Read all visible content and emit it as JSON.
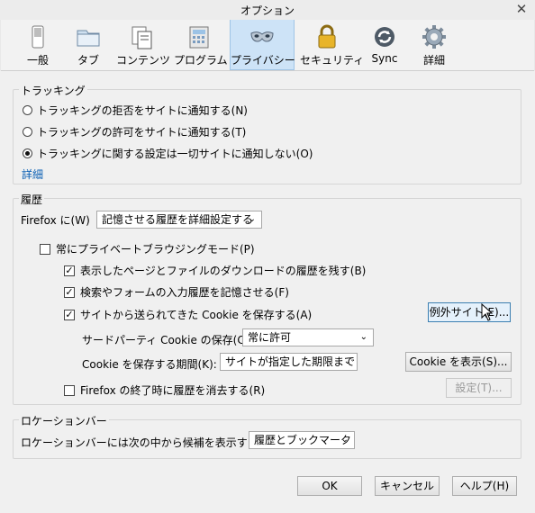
{
  "window": {
    "title": "オプション",
    "close_glyph": "✕"
  },
  "tabs": [
    {
      "label": "一般",
      "icon": "switch-icon"
    },
    {
      "label": "タブ",
      "icon": "folder-tab-icon"
    },
    {
      "label": "コンテンツ",
      "icon": "page-content-icon"
    },
    {
      "label": "プログラム",
      "icon": "calculator-icon"
    },
    {
      "label": "プライバシー",
      "icon": "mask-icon",
      "active": true
    },
    {
      "label": "セキュリティ",
      "icon": "padlock-icon"
    },
    {
      "label": "Sync",
      "icon": "sync-icon"
    },
    {
      "label": "詳細",
      "icon": "gear-icon"
    }
  ],
  "tracking": {
    "legend": "トラッキング",
    "opt_deny": "トラッキングの拒否をサイトに通知する(N)",
    "opt_allow": "トラッキングの許可をサイトに通知する(T)",
    "opt_none": "トラッキングに関する設定は一切サイトに通知しない(O)",
    "selected": "opt_none",
    "details_link": "詳細"
  },
  "history": {
    "legend": "履歴",
    "firefox_label": "Firefox に(W)",
    "firefox_select": "記憶させる履歴を詳細設定する",
    "always_private": "常にプライベートブラウジングモード(P)",
    "always_private_checked": false,
    "remember_pages": "表示したページとファイルのダウンロードの履歴を残す(B)",
    "remember_pages_checked": true,
    "remember_forms": "検索やフォームの入力履歴を記憶させる(F)",
    "remember_forms_checked": true,
    "accept_cookies": "サイトから送られてきた Cookie を保存する(A)",
    "accept_cookies_checked": true,
    "exceptions_button": "例外サイト(E)...",
    "third_party_label": "サードパーティ Cookie の保存(C):",
    "third_party_select": "常に許可",
    "keep_until_label": "Cookie を保存する期間(K):",
    "keep_until_select": "サイトが指定した期限まで",
    "show_cookies_button": "Cookie を表示(S)...",
    "clear_on_close": "Firefox の終了時に履歴を消去する(R)",
    "clear_on_close_checked": false,
    "settings_button": "設定(T)..."
  },
  "location_bar": {
    "legend": "ロケーションバー",
    "label": "ロケーションバーには次の中から候補を表示する(U):",
    "select": "履歴とブックマーク"
  },
  "footer": {
    "ok": "OK",
    "cancel": "キャンセル",
    "help": "ヘルプ(H)"
  },
  "check_glyph": "✓",
  "select_arrow": "⌄"
}
